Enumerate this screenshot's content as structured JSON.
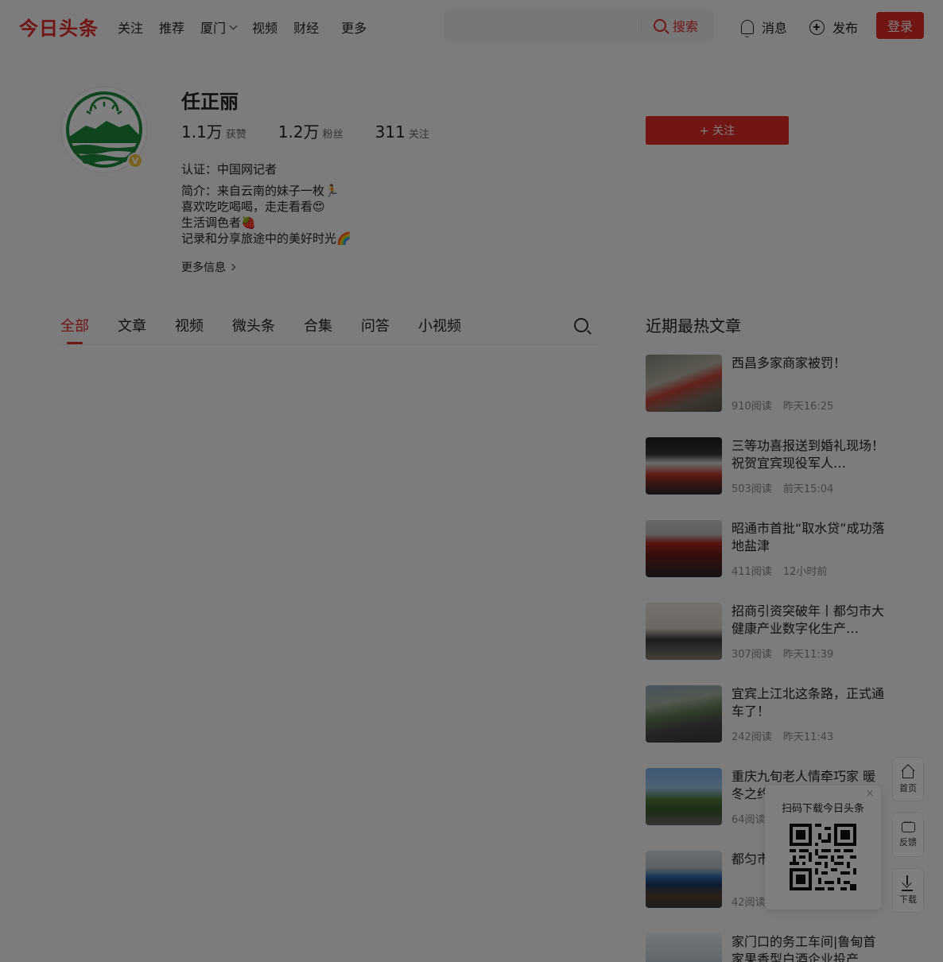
{
  "header": {
    "logo": "今日头条",
    "nav": [
      "关注",
      "推荐",
      "厦门",
      "视频",
      "财经"
    ],
    "nav_more": "更多",
    "search_placeholder": "",
    "search_button": "搜索",
    "messages": "消息",
    "publish": "发布",
    "login": "登录"
  },
  "profile": {
    "name": "任正丽",
    "stats": [
      {
        "num": "1.1万",
        "label": "获赞"
      },
      {
        "num": "1.2万",
        "label": "粉丝"
      },
      {
        "num": "311",
        "label": "关注"
      }
    ],
    "follow_button": "+ 关注",
    "certification": "认证：中国网记者",
    "bio_lines": [
      "简介：来自云南的妹子一枚🏃",
      "喜欢吃吃喝喝，走走看看😍",
      "生活调色者🍓",
      "记录和分享旅途中的美好时光🌈"
    ],
    "more_info": "更多信息"
  },
  "tabs": [
    "全部",
    "文章",
    "视频",
    "微头条",
    "合集",
    "问答",
    "小视频"
  ],
  "hot": {
    "title": "近期最热文章",
    "articles": [
      {
        "title": "西昌多家商家被罚！",
        "reads": "910阅读",
        "time": "昨天16:25"
      },
      {
        "title": "三等功喜报送到婚礼现场！祝贺宜宾现役军人…",
        "reads": "503阅读",
        "time": "前天15:04"
      },
      {
        "title": "昭通市首批“取水贷”成功落地盐津",
        "reads": "411阅读",
        "time": "12小时前"
      },
      {
        "title": "招商引资突破年丨都匀市大健康产业数字化生产…",
        "reads": "307阅读",
        "time": "昨天11:39"
      },
      {
        "title": "宜宾上江北这条路，正式通车了！",
        "reads": "242阅读",
        "time": "昨天11:43"
      },
      {
        "title": "重庆九旬老人情牵巧家 暖冬之约",
        "reads": "64阅读",
        "time": ""
      },
      {
        "title": "都匀市工程进",
        "reads": "42阅读",
        "time": ""
      },
      {
        "title": "家门口的务工车间|鲁甸首家果香型白酒企业投产",
        "reads": "",
        "time": ""
      }
    ]
  },
  "side_toolbar": {
    "home": "首页",
    "feedback": "反馈",
    "download": "下载"
  },
  "qr_popup": {
    "title": "扫码下载今日头条",
    "close": "×"
  },
  "colors": {
    "brand_red": "#e22a2a",
    "overlay": "rgba(0,0,0,0.5)"
  }
}
